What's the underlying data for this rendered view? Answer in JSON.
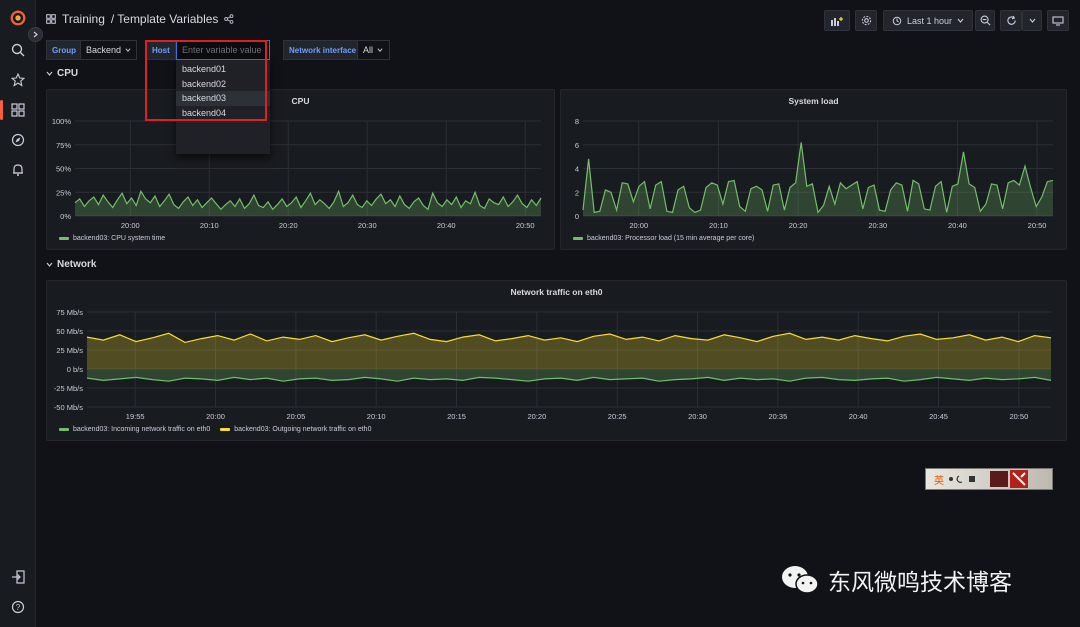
{
  "breadcrumb": {
    "folder": "Training",
    "separator": "/",
    "dashboard": "Template Variables"
  },
  "toolbar": {
    "time_range": "Last 1 hour"
  },
  "variables": {
    "group_label": "Group",
    "group_value": "Backend",
    "host_label": "Host",
    "host_placeholder": "Enter variable value",
    "host_options": [
      "backend01",
      "backend02",
      "backend03",
      "backend04"
    ],
    "host_highlighted": "backend03",
    "iface_label": "Network interface",
    "iface_value": "All"
  },
  "rows": {
    "cpu": "CPU",
    "network": "Network"
  },
  "panels": {
    "cpu": {
      "title": "CPU",
      "legend": "backend03: CPU system time",
      "y_ticks": [
        "100%",
        "75%",
        "50%",
        "25%",
        "0%"
      ],
      "x_ticks": [
        "20:00",
        "20:10",
        "20:20",
        "20:30",
        "20:40",
        "20:50"
      ]
    },
    "load": {
      "title": "System load",
      "legend": "backend03: Processor load (15 min average per core)",
      "y_ticks": [
        "8",
        "6",
        "4",
        "2",
        "0"
      ],
      "x_ticks": [
        "20:00",
        "20:10",
        "20:20",
        "20:30",
        "20:40",
        "20:50"
      ]
    },
    "net": {
      "title": "Network traffic on eth0",
      "legend_in": "backend03: Incoming network traffic on eth0",
      "legend_out": "backend03: Outgoing network traffic on eth0",
      "y_ticks": [
        "75 Mb/s",
        "50 Mb/s",
        "25 Mb/s",
        "0 b/s",
        "-25 Mb/s",
        "-50 Mb/s"
      ],
      "x_ticks": [
        "19:55",
        "20:00",
        "20:05",
        "20:10",
        "20:15",
        "20:20",
        "20:25",
        "20:30",
        "20:35",
        "20:40",
        "20:45",
        "20:50"
      ]
    }
  },
  "colors": {
    "green": "#73bf69",
    "yellow": "#fade2a",
    "accent": "#f55f3e",
    "blue": "#6e9fff"
  },
  "overlay": {
    "badge_char": "英",
    "watermark": "东风微鸣技术博客"
  },
  "chart_data": [
    {
      "type": "area",
      "title": "CPU",
      "ylim": [
        0,
        100
      ],
      "unit": "%",
      "x_range": [
        "19:53",
        "20:52"
      ],
      "series": [
        {
          "name": "backend03: CPU system time",
          "color": "#73bf69",
          "values": [
            14,
            18,
            10,
            16,
            20,
            12,
            22,
            15,
            9,
            17,
            24,
            13,
            19,
            11,
            26,
            18,
            14,
            21,
            10,
            16,
            23,
            12,
            8,
            15,
            20,
            11,
            17,
            9,
            14,
            19,
            13,
            7,
            12,
            16,
            10,
            18,
            8,
            13,
            22,
            11,
            9,
            15,
            7,
            12,
            18,
            10,
            14,
            20,
            9,
            16,
            24,
            12,
            17,
            13,
            8,
            15,
            26,
            10,
            14,
            22,
            12,
            9,
            16,
            11,
            18,
            23,
            13,
            17,
            10,
            21,
            12,
            8,
            15,
            19,
            11,
            7,
            24,
            14,
            10,
            17,
            12,
            20,
            9,
            16,
            13,
            25,
            11,
            8,
            18,
            14,
            12,
            20,
            10,
            15,
            22,
            13,
            9,
            17,
            11,
            19
          ]
        }
      ]
    },
    {
      "type": "line",
      "title": "System load",
      "ylim": [
        0,
        8
      ],
      "x_range": [
        "19:53",
        "20:52"
      ],
      "series": [
        {
          "name": "backend03: Processor load (15 min average per core)",
          "color": "#73bf69",
          "values": [
            0.5,
            4.8,
            0.3,
            0.4,
            2.2,
            2.0,
            0.5,
            2.8,
            2.7,
            1.2,
            2.5,
            2.9,
            0.6,
            2.6,
            2.9,
            0.4,
            0.3,
            2.2,
            2.5,
            0.7,
            0.3,
            0.5,
            2.4,
            2.8,
            2.6,
            1.0,
            2.9,
            3.0,
            0.8,
            0.4,
            2.3,
            2.5,
            2.2,
            0.4,
            2.6,
            2.7,
            0.5,
            2.4,
            2.8,
            6.2,
            2.5,
            2.7,
            0.3,
            0.9,
            2.5,
            1.0,
            2.8,
            2.3,
            2.6,
            2.9,
            0.6,
            2.4,
            2.6,
            0.5,
            0.4,
            2.2,
            2.8,
            2.6,
            0.4,
            3.0,
            2.7,
            0.6,
            0.5,
            2.5,
            2.9,
            0.3,
            2.5,
            2.7,
            5.4,
            2.7,
            2.4,
            0.4,
            1.0,
            2.7,
            2.6,
            0.6,
            2.8,
            3.0,
            2.6,
            4.2,
            2.4,
            0.8,
            1.6,
            2.9,
            3.0
          ]
        }
      ]
    },
    {
      "type": "area",
      "title": "Network traffic on eth0",
      "ylim": [
        -50,
        75
      ],
      "unit": "Mb/s",
      "x_range": [
        "19:52",
        "20:52"
      ],
      "series": [
        {
          "name": "backend03: Incoming network traffic on eth0",
          "color": "#73bf69",
          "values": [
            -12,
            -15,
            -13,
            -11,
            -14,
            -16,
            -12,
            -13,
            -15,
            -11,
            -14,
            -12,
            -16,
            -13,
            -12,
            -15,
            -14,
            -11,
            -13,
            -16,
            -12,
            -14,
            -13,
            -15,
            -11,
            -12,
            -14,
            -16,
            -13,
            -12,
            -15,
            -11,
            -14,
            -13,
            -12,
            -16,
            -14,
            -13,
            -11,
            -15,
            -12,
            -14,
            -13,
            -16,
            -12,
            -11,
            -14,
            -15,
            -13,
            -12,
            -16,
            -14,
            -11,
            -13,
            -15,
            -12,
            -14,
            -13,
            -11,
            -15
          ]
        },
        {
          "name": "backend03: Outgoing network traffic on eth0",
          "color": "#fade2a",
          "values": [
            42,
            38,
            45,
            36,
            41,
            47,
            35,
            40,
            44,
            38,
            46,
            37,
            42,
            39,
            44,
            36,
            41,
            45,
            38,
            43,
            47,
            39,
            36,
            42,
            45,
            37,
            40,
            44,
            38,
            41,
            36,
            43,
            46,
            39,
            42,
            37,
            44,
            40,
            38,
            45,
            41,
            36,
            43,
            47,
            39,
            42,
            38,
            44,
            40,
            37,
            43,
            46,
            39,
            41,
            45,
            38,
            42,
            36,
            44,
            41
          ]
        }
      ]
    }
  ]
}
